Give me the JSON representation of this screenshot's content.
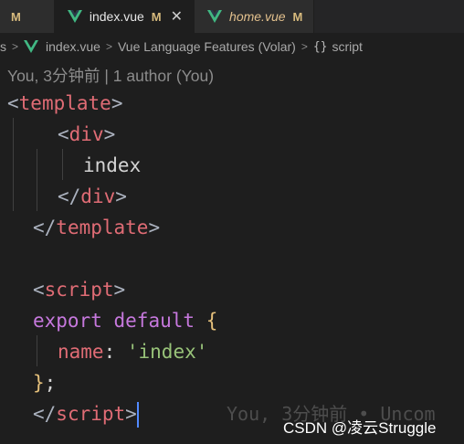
{
  "tabs": [
    {
      "name": "",
      "status": "M"
    },
    {
      "name": "index.vue",
      "status": "M",
      "close": "✕"
    },
    {
      "name": "home.vue",
      "status": "M"
    }
  ],
  "breadcrumb": {
    "lead": "s",
    "file": "index.vue",
    "provider": "Vue Language Features (Volar)",
    "symbol_icon": "{}",
    "symbol": "script"
  },
  "codelens": "You, 3分钟前 | 1 author (You)",
  "code": {
    "l1": {
      "open": "<",
      "tag": "template",
      "close": ">"
    },
    "l2": {
      "open": "<",
      "tag": "div",
      "close": ">"
    },
    "l3": {
      "text": "index"
    },
    "l4": {
      "open": "</",
      "tag": "div",
      "close": ">"
    },
    "l5": {
      "open": "</",
      "tag": "template",
      "close": ">"
    },
    "l7": {
      "open": "<",
      "tag": "script",
      "close": ">"
    },
    "l8": {
      "kw1": "export",
      "kw2": "default",
      "brace": "{"
    },
    "l9": {
      "prop": "name",
      "colon": ": ",
      "str": "'index'"
    },
    "l10": {
      "brace": "}",
      "semi": ";"
    },
    "l11": {
      "open": "</",
      "tag": "script",
      "close": ">"
    }
  },
  "blame": "You, 3分钟前 • Uncom",
  "watermark": "CSDN @凌云Struggle",
  "colors": {
    "vue_green": "#41b883",
    "modified": "#d7ba7d",
    "cursor": "#528bff"
  },
  "icons": [
    "vue-icon",
    "chevron-right-icon",
    "braces-icon",
    "close-icon"
  ]
}
